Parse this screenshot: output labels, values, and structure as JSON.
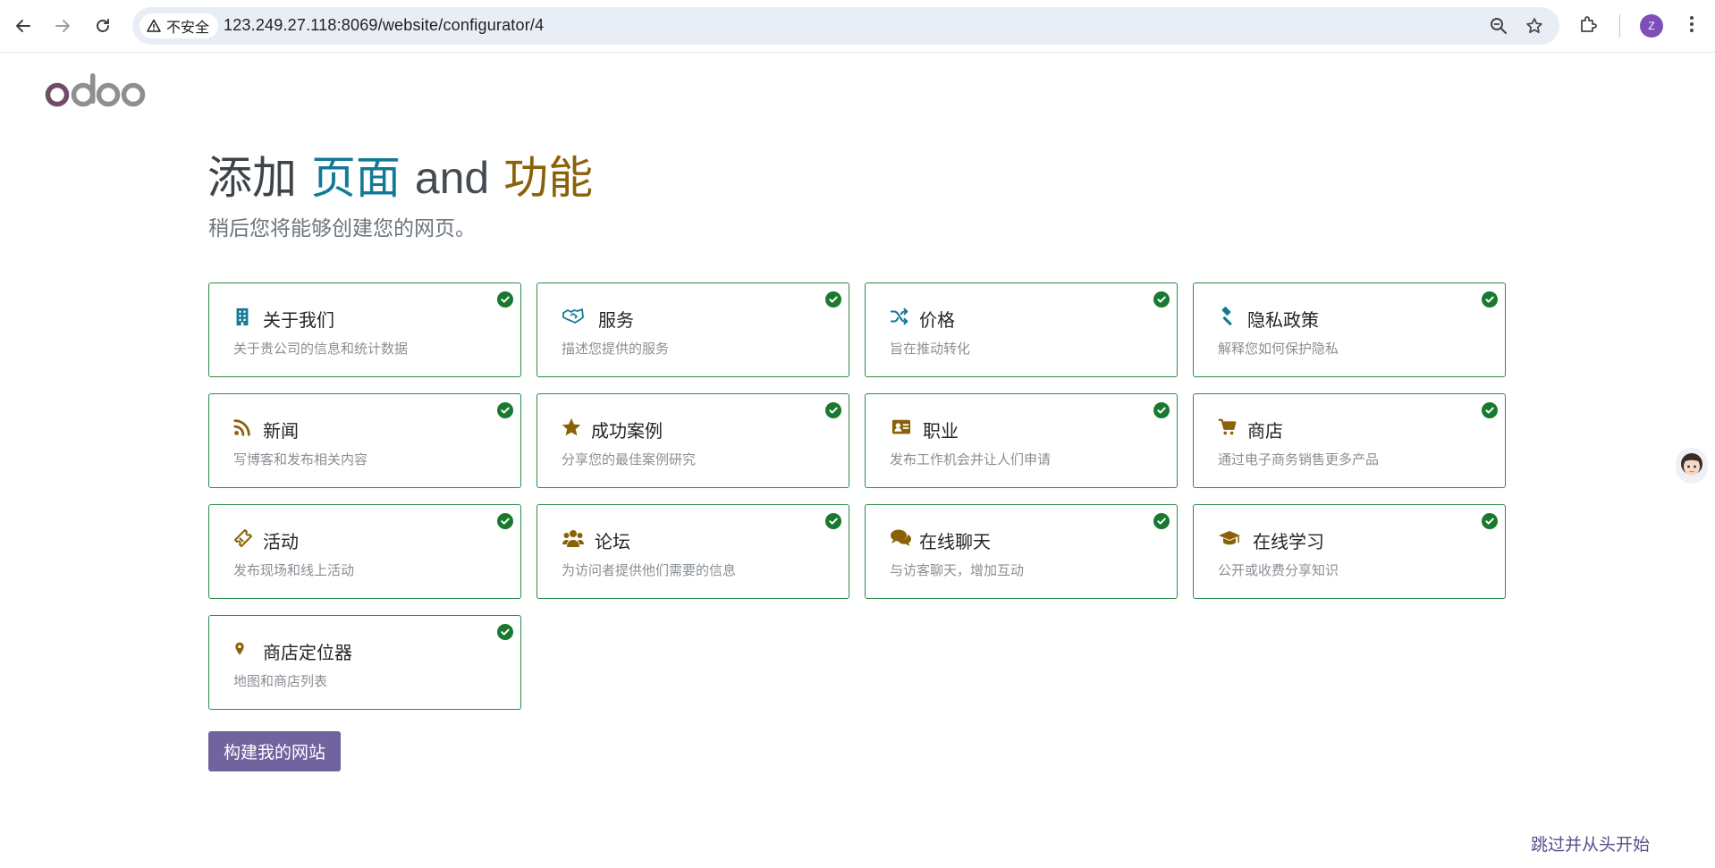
{
  "browser": {
    "security_label": "不安全",
    "url": "123.249.27.118:8069/website/configurator/4",
    "profile_initial": "Z"
  },
  "page": {
    "logo_text": "odoo",
    "heading": {
      "prefix": "添加",
      "pages": "页面",
      "and": "and",
      "features": "功能"
    },
    "subtitle": "稍后您将能够创建您的网页。",
    "features": [
      {
        "icon": "building-icon",
        "title": "关于我们",
        "desc": "关于贵公司的信息和统计数据",
        "color": "#127a96",
        "checked": true
      },
      {
        "icon": "handshake-icon",
        "title": "服务",
        "desc": "描述您提供的服务",
        "color": "#127a96",
        "checked": true
      },
      {
        "icon": "shuffle-icon",
        "title": "价格",
        "desc": "旨在推动转化",
        "color": "#127a96",
        "checked": true
      },
      {
        "icon": "gavel-icon",
        "title": "隐私政策",
        "desc": "解释您如何保护隐私",
        "color": "#127a96",
        "checked": true
      },
      {
        "icon": "rss-icon",
        "title": "新闻",
        "desc": "写博客和发布相关内容",
        "color": "#8a6107",
        "checked": true
      },
      {
        "icon": "star-icon",
        "title": "成功案例",
        "desc": "分享您的最佳案例研究",
        "color": "#8a6107",
        "checked": true
      },
      {
        "icon": "id-card-icon",
        "title": "职业",
        "desc": "发布工作机会并让人们申请",
        "color": "#8a6107",
        "checked": true
      },
      {
        "icon": "shopping-cart-icon",
        "title": "商店",
        "desc": "通过电子商务销售更多产品",
        "color": "#8a6107",
        "checked": true
      },
      {
        "icon": "ticket-icon",
        "title": "活动",
        "desc": "发布现场和线上活动",
        "color": "#8a6107",
        "checked": true
      },
      {
        "icon": "users-icon",
        "title": "论坛",
        "desc": "为访问者提供他们需要的信息",
        "color": "#8a6107",
        "checked": true
      },
      {
        "icon": "comments-icon",
        "title": "在线聊天",
        "desc": "与访客聊天，增加互动",
        "color": "#8a6107",
        "checked": true
      },
      {
        "icon": "graduation-cap-icon",
        "title": "在线学习",
        "desc": "公开或收费分享知识",
        "color": "#8a6107",
        "checked": true
      },
      {
        "icon": "map-marker-icon",
        "title": "商店定位器",
        "desc": "地图和商店列表",
        "color": "#8a6107",
        "checked": true
      }
    ],
    "build_button": "构建我的网站",
    "skip_link": "跳过并从头开始"
  },
  "colors": {
    "primary": "#71639e",
    "card_border": "#2e8b47",
    "check_badge": "#19792f",
    "pages_word": "#127a96",
    "features_word": "#8a6107"
  }
}
